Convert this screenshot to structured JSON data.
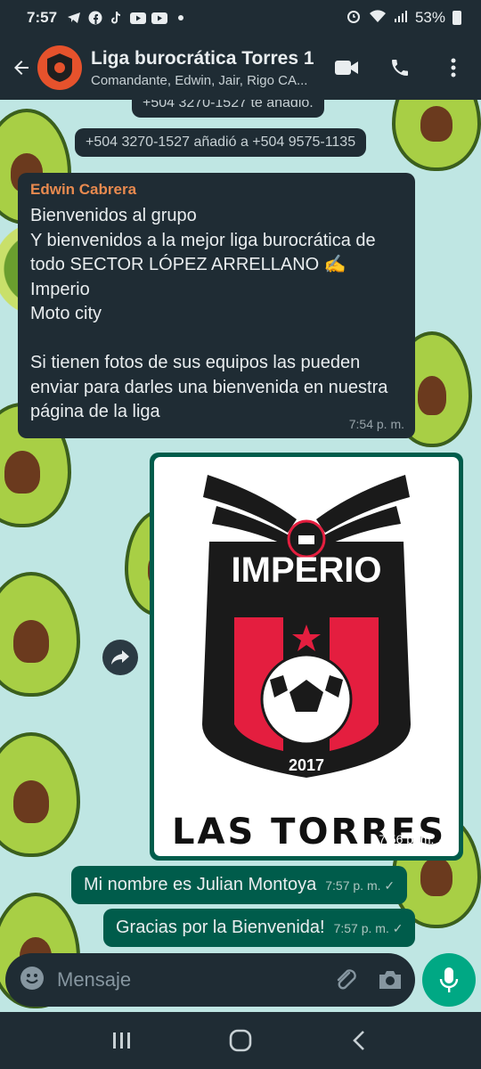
{
  "status_bar": {
    "time": "7:57",
    "battery": "53%"
  },
  "header": {
    "title": "Liga burocrática Torres 1",
    "subtitle": "Comandante, Edwin, Jair, Rigo CA..."
  },
  "system_messages": {
    "partial": "+504 3270-1527 te añadió.",
    "added": "+504 3270-1527 añadió a +504 9575-1135"
  },
  "incoming_message": {
    "sender": "Edwin Cabrera",
    "text": "Bienvenidos al grupo\nY bienvenidos a la mejor liga burocrática de todo SECTOR LÓPEZ ARRELLANO ✍️\nImperio\nMoto city\n\nSi tienen fotos de sus equipos las pueden enviar para darles una bienvenida en nuestra página de la liga",
    "time": "7:54 p. m."
  },
  "image_message": {
    "logo_title": "IMPERIO",
    "logo_year": "2017",
    "logo_bottom": "LAS TORRES",
    "time": "7:56 p. m. ✓"
  },
  "outgoing_messages": [
    {
      "text": "Mi nombre es Julian Montoya",
      "time": "7:57 p. m. ✓"
    },
    {
      "text": "Gracias por la Bienvenida!",
      "time": "7:57 p. m. ✓"
    }
  ],
  "composer": {
    "placeholder": "Mensaje"
  },
  "colors": {
    "header": "#1f2c34",
    "outgoing": "#005c4b",
    "accent": "#00a884",
    "wallpaper": "#bfe6e3"
  }
}
